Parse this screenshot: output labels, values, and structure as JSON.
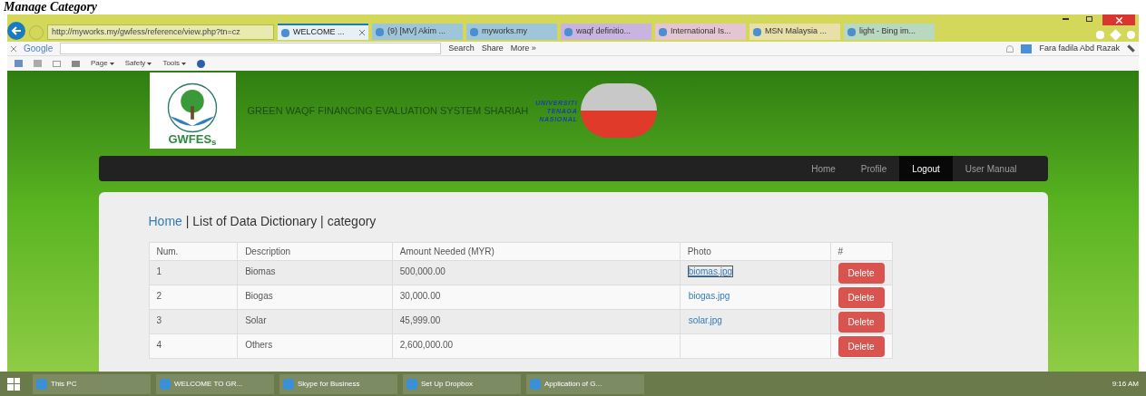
{
  "document_heading": "Manage Category",
  "browser": {
    "url": "http://myworks.my/gwfess/reference/view.php?tn=cz",
    "tabs": [
      {
        "label": "WELCOME ...",
        "selected": true
      },
      {
        "label": "(9) [MV] Akim ...",
        "selected": false
      },
      {
        "label": "myworks.my",
        "selected": false
      },
      {
        "label": "waqf definitio...",
        "selected": false
      },
      {
        "label": "International Is...",
        "selected": false
      },
      {
        "label": "MSN Malaysia ...",
        "selected": false
      },
      {
        "label": "light - Bing im...",
        "selected": false
      }
    ],
    "toolbar": {
      "brand": "Google",
      "search": "Search",
      "share": "Share",
      "more": "More »",
      "user": "Fara fadila Abd Razak"
    },
    "commands": [
      "Page",
      "Safety",
      "Tools"
    ]
  },
  "site": {
    "logo_text": "GWFES$_{s}$",
    "title": "GREEN WAQF FINANCING EVALUATION SYSTEM SHARIAH",
    "university": [
      "UNIVERSITI",
      "TENAGA",
      "NASIONAL"
    ],
    "nav": [
      {
        "label": "Home",
        "selected": false
      },
      {
        "label": "Profile",
        "selected": false
      },
      {
        "label": "Logout",
        "selected": true
      },
      {
        "label": "User Manual",
        "selected": false
      }
    ],
    "breadcrumb": {
      "link": "Home",
      "rest": " | List of Data Dictionary | category"
    },
    "table": {
      "columns": [
        "Num.",
        "Description",
        "Amount Needed (MYR)",
        "Photo",
        "#"
      ],
      "rows": [
        {
          "num": "1",
          "description": "Biomas",
          "amount": "500,000.00",
          "photo": "biomas.jpg",
          "focused": true,
          "action": "Delete"
        },
        {
          "num": "2",
          "description": "Biogas",
          "amount": "30,000.00",
          "photo": "biogas.jpg",
          "focused": false,
          "action": "Delete"
        },
        {
          "num": "3",
          "description": "Solar",
          "amount": "45,999.00",
          "photo": "solar.jpg",
          "focused": false,
          "action": "Delete"
        },
        {
          "num": "4",
          "description": "Others",
          "amount": "2,600,000.00",
          "photo": "",
          "focused": false,
          "action": "Delete"
        }
      ]
    }
  },
  "taskbar": {
    "items": [
      "This PC",
      "WELCOME TO GR...",
      "Skype for Business",
      "Set Up Dropbox",
      "Application of G..."
    ],
    "clock": "9:16 AM"
  }
}
